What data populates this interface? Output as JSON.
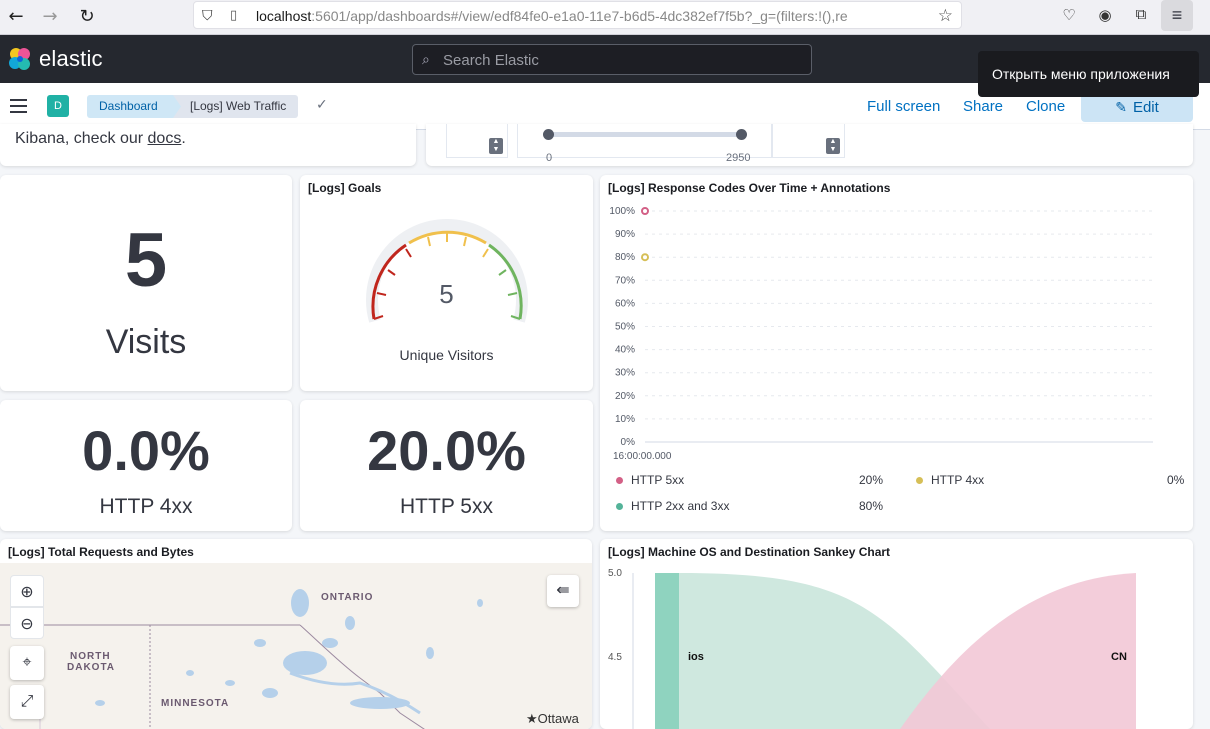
{
  "browser": {
    "url_host": "localhost",
    "url_rest": ":5601/app/dashboards#/view/edf84fe0-e1a0-11e7-b6d5-4dc382ef7f5b?_g=(filters:!(),re"
  },
  "header": {
    "logo_text": "elastic",
    "search_placeholder": "Search Elastic",
    "tooltip": "Открыть меню приложения"
  },
  "subheader": {
    "space_initial": "D",
    "breadcrumbs": [
      "Dashboard",
      "[Logs] Web Traffic"
    ],
    "actions": [
      "Full screen",
      "Share",
      "Clone",
      "Edit"
    ]
  },
  "top_panels": {
    "markdown_text": "Kibana, check our ",
    "markdown_link": "docs",
    "markdown_tail": ".",
    "slider_min_label": "0",
    "slider_max_label": "2950"
  },
  "visits": {
    "value": "5",
    "label": "Visits"
  },
  "goals": {
    "title": "[Logs] Goals",
    "value": "5",
    "label": "Unique Visitors"
  },
  "http4xx": {
    "value": "0.0%",
    "label": "HTTP 4xx"
  },
  "http5xx": {
    "value": "20.0%",
    "label": "HTTP 5xx"
  },
  "response_codes": {
    "title": "[Logs] Response Codes Over Time + Annotations",
    "legend": [
      {
        "name": "HTTP 5xx",
        "pct": "20%",
        "color": "#d36086"
      },
      {
        "name": "HTTP 4xx",
        "pct": "0%",
        "color": "#d6bf57"
      },
      {
        "name": "HTTP 2xx and 3xx",
        "pct": "80%",
        "color": "#54b399"
      }
    ]
  },
  "map": {
    "title": "[Logs] Total Requests and Bytes",
    "labels": [
      "ONTARIO",
      "NORTH",
      "DAKOTA",
      "MINNESOTA",
      "Ottawa"
    ]
  },
  "sankey": {
    "title": "[Logs] Machine OS and Destination Sankey Chart",
    "y_ticks": [
      "5.0",
      "4.5"
    ],
    "node_left": "ios",
    "node_right": "CN"
  },
  "chart_data": {
    "type": "scatter",
    "title": "[Logs] Response Codes Over Time + Annotations",
    "xlabel": "",
    "ylabel": "",
    "x": [
      "16:00:00.000"
    ],
    "ylim": [
      0,
      100
    ],
    "y_ticks": [
      "0%",
      "10%",
      "20%",
      "30%",
      "40%",
      "50%",
      "60%",
      "70%",
      "80%",
      "90%",
      "100%"
    ],
    "series": [
      {
        "name": "HTTP 5xx",
        "color": "#d36086",
        "values": [
          100
        ]
      },
      {
        "name": "HTTP 4xx",
        "color": "#d6bf57",
        "values": [
          80
        ]
      }
    ],
    "grid": true
  }
}
